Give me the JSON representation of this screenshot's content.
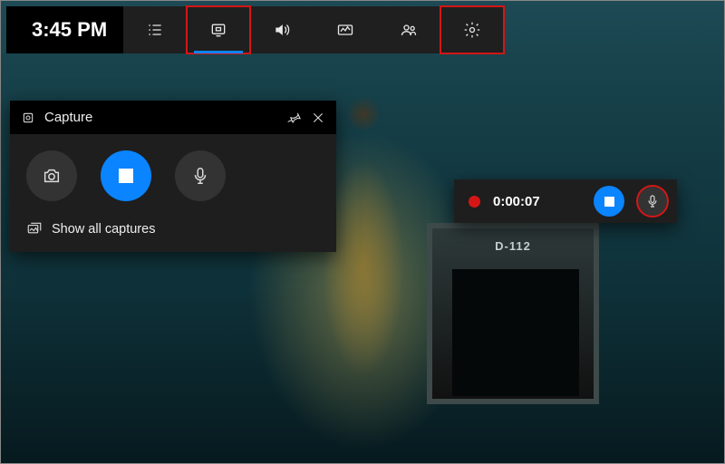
{
  "topbar": {
    "time": "3:45 PM",
    "icons": {
      "xbox": "xbox-logo-icon",
      "widgets": "widgets-list-icon",
      "capture": "capture-icon",
      "audio": "volume-icon",
      "performance": "performance-icon",
      "social": "people-icon",
      "settings": "gear-icon"
    }
  },
  "capture_panel": {
    "title": "Capture",
    "buttons": {
      "screenshot": "camera-icon",
      "stop": "stop-icon",
      "mic": "microphone-icon"
    },
    "show_all_label": "Show all captures"
  },
  "recording": {
    "elapsed": "0:00:07",
    "status_color": "#d41616"
  },
  "background": {
    "door_label": "D-112"
  },
  "colors": {
    "accent": "#0a84ff",
    "highlight": "#d41616"
  }
}
